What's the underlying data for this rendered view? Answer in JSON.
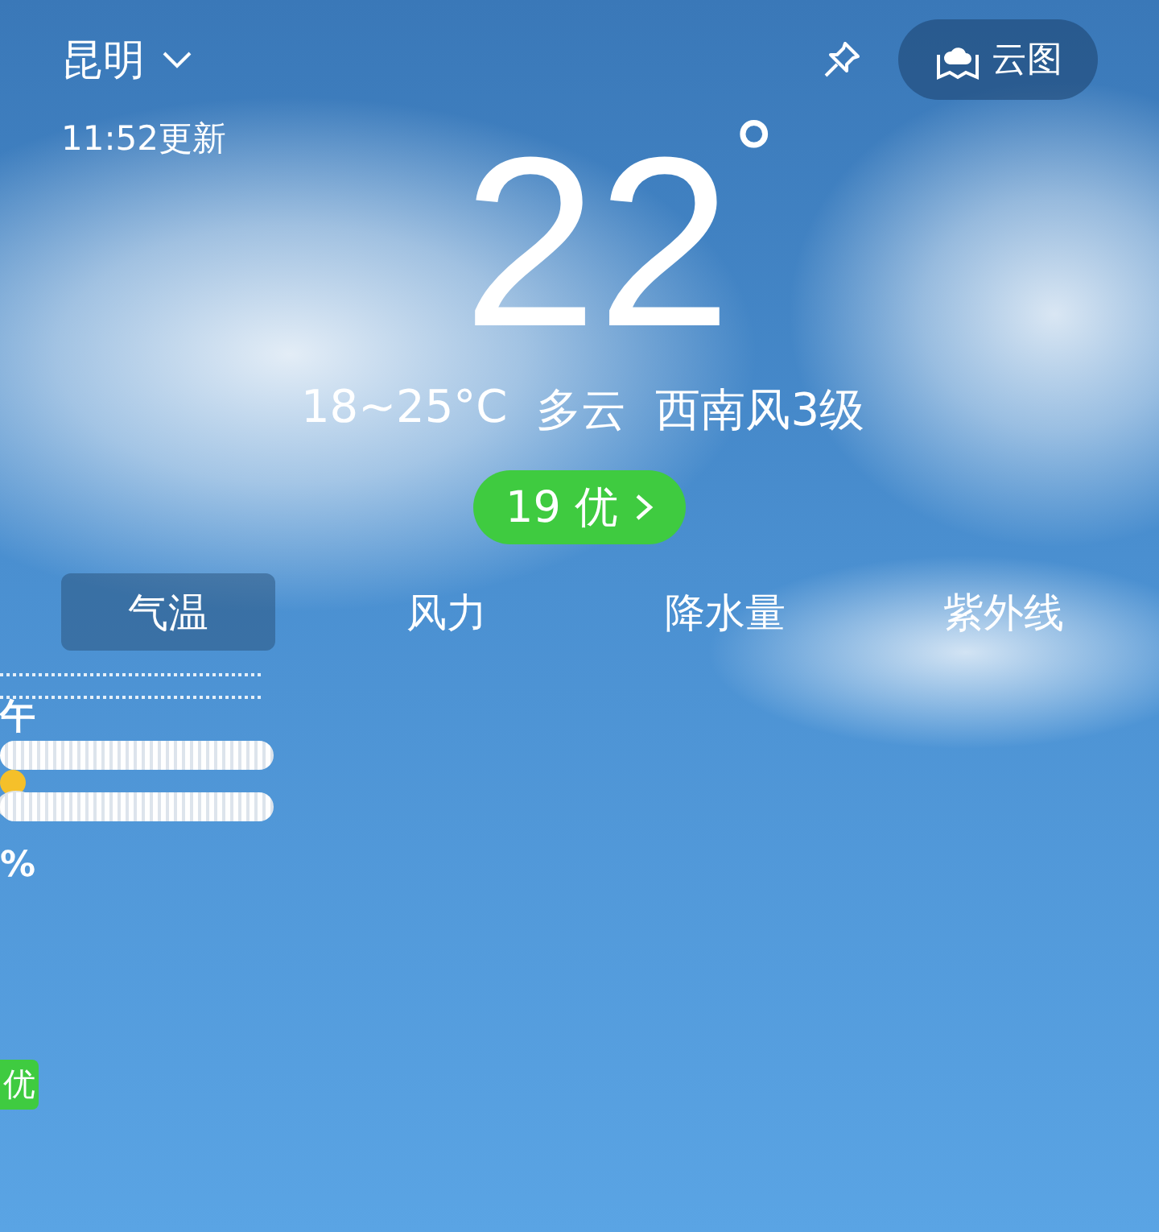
{
  "header": {
    "city": "昆明",
    "updated": "11:52更新",
    "map_button": "云图"
  },
  "current": {
    "temperature": "22",
    "degree": "°",
    "range": "18~25°C",
    "condition": "多云",
    "wind": "西南风3级"
  },
  "aqi": {
    "text": "19 优"
  },
  "tabs": [
    {
      "label": "气温",
      "selected": true
    },
    {
      "label": "风力",
      "selected": false
    },
    {
      "label": "降水量",
      "selected": false
    },
    {
      "label": "紫外线",
      "selected": false
    }
  ],
  "fragments": {
    "hour": "午",
    "percent": "%",
    "aqi_badge": "优"
  }
}
